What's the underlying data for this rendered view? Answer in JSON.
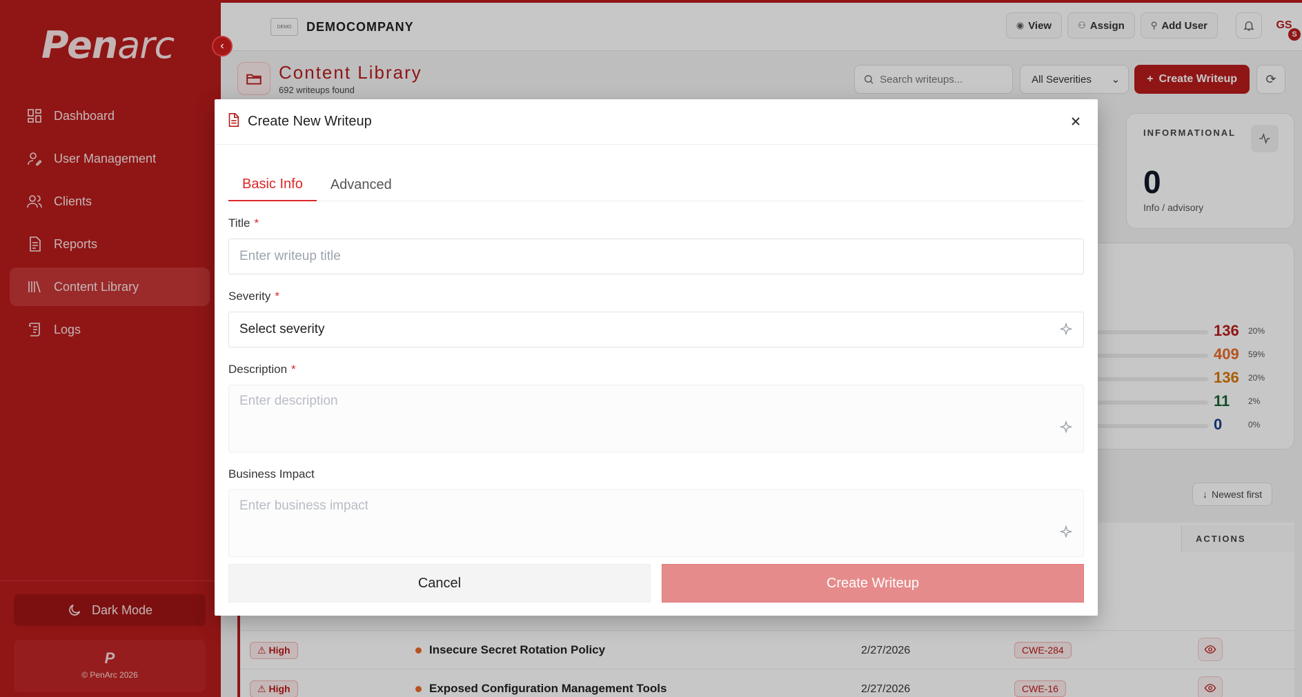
{
  "sidebar": {
    "brand": "Penarc",
    "items": [
      {
        "label": "Dashboard",
        "icon": "dashboard-grid-icon",
        "active": false
      },
      {
        "label": "User Management",
        "icon": "user-edit-icon",
        "active": false
      },
      {
        "label": "Clients",
        "icon": "users-icon",
        "active": false
      },
      {
        "label": "Reports",
        "icon": "report-document-icon",
        "active": false
      },
      {
        "label": "Content Library",
        "icon": "library-books-icon",
        "active": true
      },
      {
        "label": "Logs",
        "icon": "scroll-log-icon",
        "active": false
      }
    ],
    "dark_mode_label": "Dark Mode",
    "footer_mark": "P",
    "footer_copyright": "© PenArc 2026"
  },
  "header": {
    "company_logo_text": "DEMO",
    "company_name": "DEMOCOMPANY",
    "view_label": "View",
    "assign_label": "Assign",
    "add_user_label": "Add User",
    "avatar_initials": "GS",
    "avatar_badge": "S"
  },
  "page": {
    "title": "Content Library",
    "subtitle": "692 writeups found",
    "search_placeholder": "Search writeups...",
    "severity_filter": "All Severities",
    "create_button": "Create Writeup"
  },
  "stats": {
    "informational": {
      "label": "INFORMATIONAL",
      "value": "0",
      "caption": "Info / advisory"
    },
    "distribution": [
      {
        "value": "136",
        "pct": "20%",
        "color": "#b91c1c"
      },
      {
        "value": "409",
        "pct": "59%",
        "color": "#ea6b2a"
      },
      {
        "value": "136",
        "pct": "20%",
        "color": "#d97706"
      },
      {
        "value": "11",
        "pct": "2%",
        "color": "#166534"
      },
      {
        "value": "0",
        "pct": "0%",
        "color": "#1e3a8a"
      }
    ]
  },
  "table": {
    "sort_label": "Newest first",
    "actions_header": "ACTIONS",
    "rows": [
      {
        "severity": "High",
        "title": "Insecure Secret Rotation Policy",
        "date": "2/27/2026",
        "cwe": "CWE-284"
      },
      {
        "severity": "High",
        "title": "Exposed Configuration Management Tools",
        "date": "2/27/2026",
        "cwe": "CWE-16"
      }
    ]
  },
  "modal": {
    "title": "Create New Writeup",
    "tabs": [
      "Basic Info",
      "Advanced"
    ],
    "fields": {
      "title_label": "Title",
      "title_placeholder": "Enter writeup title",
      "severity_label": "Severity",
      "severity_value": "Select severity",
      "description_label": "Description",
      "description_placeholder": "Enter description",
      "impact_label": "Business Impact",
      "impact_placeholder": "Enter business impact"
    },
    "required_mark": "*",
    "cancel_label": "Cancel",
    "submit_label": "Create Writeup"
  },
  "colors": {
    "brand_red": "#b91c1c",
    "active_tab": "#dc2626",
    "disabled_submit": "#e68b8b"
  }
}
